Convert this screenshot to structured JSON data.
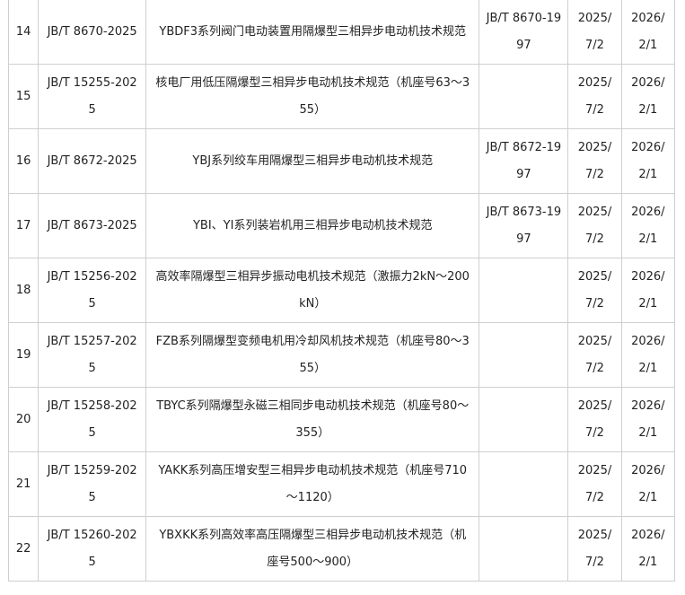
{
  "rows": [
    {
      "idx": "14",
      "code": "JB/T 8670-2025",
      "name": "YBDF3系列阀门电动装置用隔爆型三相异步电动机技术规范",
      "replaces": "JB/T 8670-1997",
      "publish": "2025/7/2",
      "effective": "2026/2/1"
    },
    {
      "idx": "15",
      "code": "JB/T 15255-2025",
      "name": "核电厂用低压隔爆型三相异步电动机技术规范（机座号63～355）",
      "replaces": "",
      "publish": "2025/7/2",
      "effective": "2026/2/1"
    },
    {
      "idx": "16",
      "code": "JB/T 8672-2025",
      "name": "YBJ系列绞车用隔爆型三相异步电动机技术规范",
      "replaces": "JB/T 8672-1997",
      "publish": "2025/7/2",
      "effective": "2026/2/1"
    },
    {
      "idx": "17",
      "code": "JB/T 8673-2025",
      "name": "YBI、YI系列装岩机用三相异步电动机技术规范",
      "replaces": "JB/T 8673-1997",
      "publish": "2025/7/2",
      "effective": "2026/2/1"
    },
    {
      "idx": "18",
      "code": "JB/T 15256-2025",
      "name": "高效率隔爆型三相异步振动电机技术规范（激振力2kN～200kN）",
      "replaces": "",
      "publish": "2025/7/2",
      "effective": "2026/2/1"
    },
    {
      "idx": "19",
      "code": "JB/T 15257-2025",
      "name": "FZB系列隔爆型变频电机用冷却风机技术规范（机座号80～355）",
      "replaces": "",
      "publish": "2025/7/2",
      "effective": "2026/2/1"
    },
    {
      "idx": "20",
      "code": "JB/T 15258-2025",
      "name": "TBYC系列隔爆型永磁三相同步电动机技术规范（机座号80～355）",
      "replaces": "",
      "publish": "2025/7/2",
      "effective": "2026/2/1"
    },
    {
      "idx": "21",
      "code": "JB/T 15259-2025",
      "name": "YAKK系列高压增安型三相异步电动机技术规范（机座号710～1120）",
      "replaces": "",
      "publish": "2025/7/2",
      "effective": "2026/2/1"
    },
    {
      "idx": "22",
      "code": "JB/T 15260-2025",
      "name": "YBXKK系列高效率高压隔爆型三相异步电动机技术规范（机座号500～900）",
      "replaces": "",
      "publish": "2025/7/2",
      "effective": "2026/2/1"
    }
  ]
}
